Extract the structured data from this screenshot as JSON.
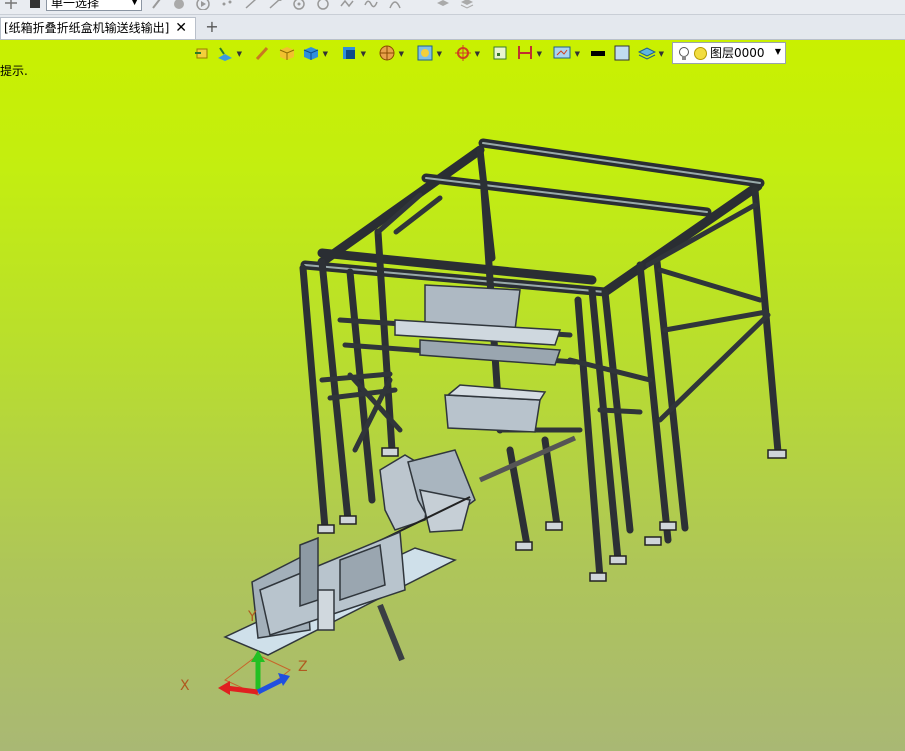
{
  "toolbar": {
    "selection_mode": "单一选择"
  },
  "tabs": {
    "document_title": "[纸箱折叠折纸盒机输送线输出]",
    "close_symbol": "✕",
    "new_tab_symbol": "+"
  },
  "viewport": {
    "hint_text": "提示.",
    "background_top": "#c9f000",
    "background_bottom": "#a9b874"
  },
  "view_toolbar": {
    "layer_label": "图层0000",
    "fill_color": "#c0dcf0",
    "line_color": "#000000"
  },
  "triad": {
    "x_label": "X",
    "y_label": "Y",
    "z_label": "Z"
  }
}
